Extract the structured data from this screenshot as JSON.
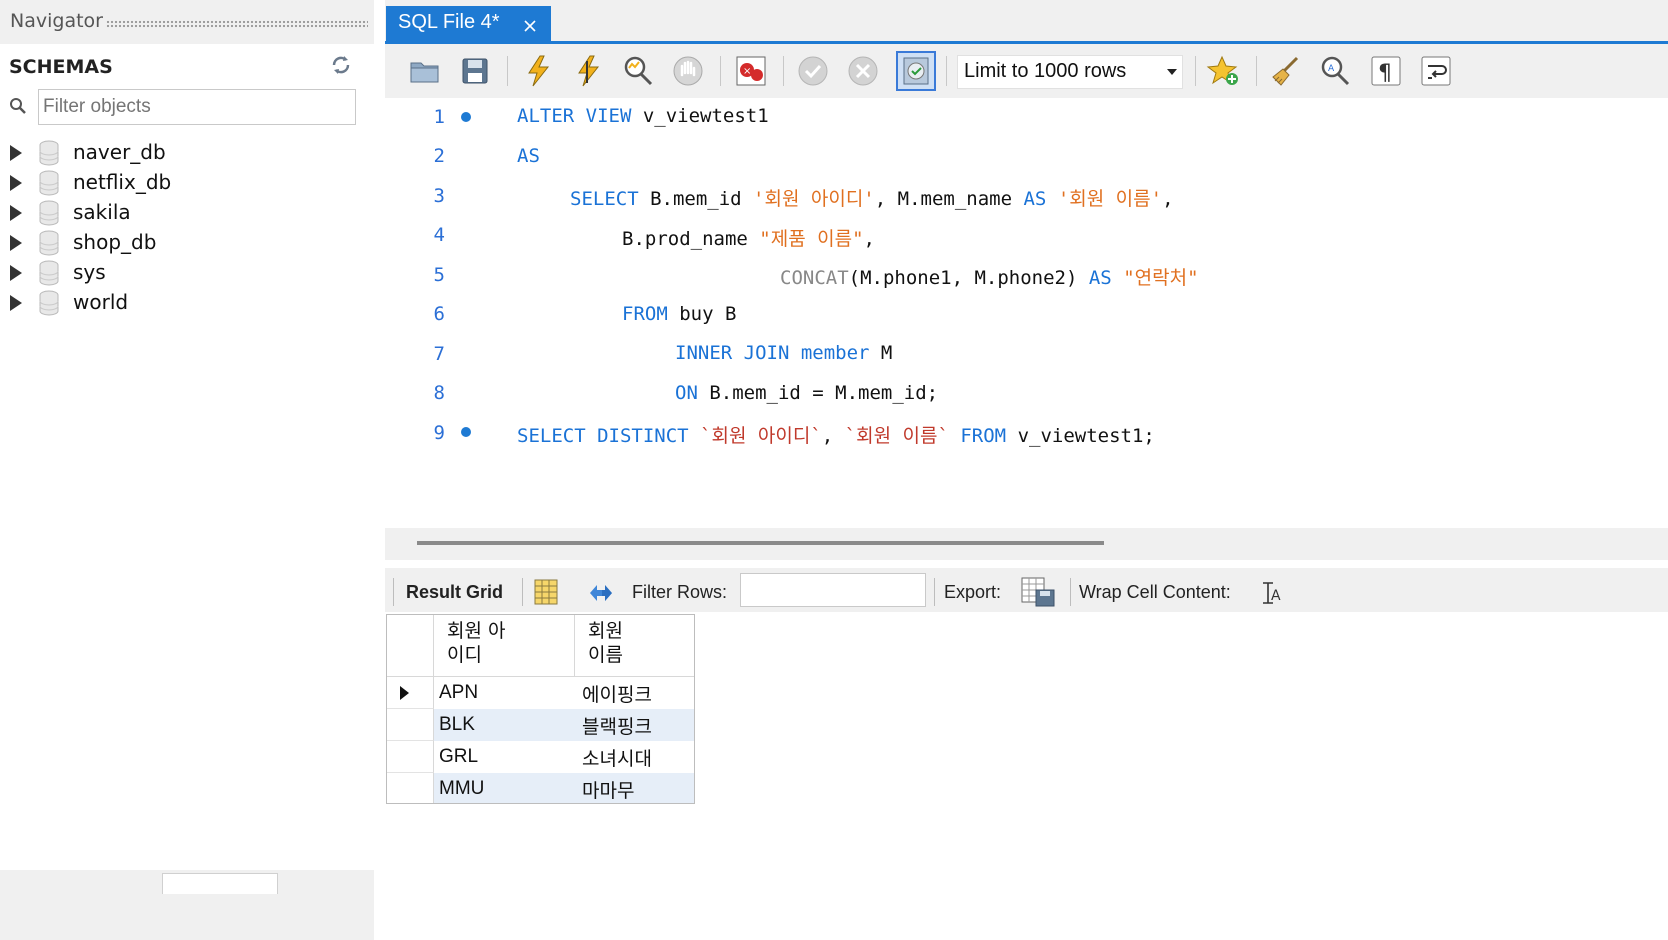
{
  "navigator": {
    "title": "Navigator",
    "schemas_label": "SCHEMAS",
    "filter_placeholder": "Filter objects",
    "schemas": [
      "naver_db",
      "netflix_db",
      "sakila",
      "shop_db",
      "sys",
      "world"
    ]
  },
  "editor": {
    "tab_title": "SQL File 4*",
    "limit_label": "Limit to 1000 rows",
    "lines": [
      "1",
      "2",
      "3",
      "4",
      "5",
      "6",
      "7",
      "8",
      "9"
    ],
    "code": {
      "l1": [
        "ALTER VIEW",
        " v_viewtest1"
      ],
      "l2": [
        "AS"
      ],
      "l3": [
        "SELECT",
        " B.mem_id ",
        "'회원 아이디'",
        ", M.mem_name ",
        "AS",
        " ",
        "'회원 이름'",
        ","
      ],
      "l4": [
        "B.prod_name ",
        "\"제품 이름\"",
        ","
      ],
      "l5": [
        "CONCAT",
        "(M.phone1, M.phone2) ",
        "AS",
        " ",
        "\"연락처\""
      ],
      "l6": [
        "FROM",
        " buy B"
      ],
      "l7": [
        "INNER JOIN",
        " ",
        "member",
        " M"
      ],
      "l8": [
        "ON",
        " B.mem_id = M.mem_id;"
      ],
      "l9": [
        "SELECT DISTINCT",
        " ",
        "`회원 아이디`",
        ", ",
        "`회원 이름`",
        " ",
        "FROM",
        " v_viewtest1;"
      ]
    }
  },
  "results": {
    "result_grid_label": "Result Grid",
    "filter_rows_label": "Filter Rows:",
    "export_label": "Export:",
    "wrap_label": "Wrap Cell Content:",
    "columns": [
      "회원 아\n이디",
      "회원\n이름"
    ],
    "rows": [
      [
        "APN",
        "에이핑크"
      ],
      [
        "BLK",
        "블랙핑크"
      ],
      [
        "GRL",
        "소녀시대"
      ],
      [
        "MMU",
        "마마무"
      ]
    ]
  },
  "colors": {
    "accent": "#1e7ad3",
    "keyword": "#1a72d6",
    "string": "#e07020",
    "row_alt": "#e6eef8"
  }
}
